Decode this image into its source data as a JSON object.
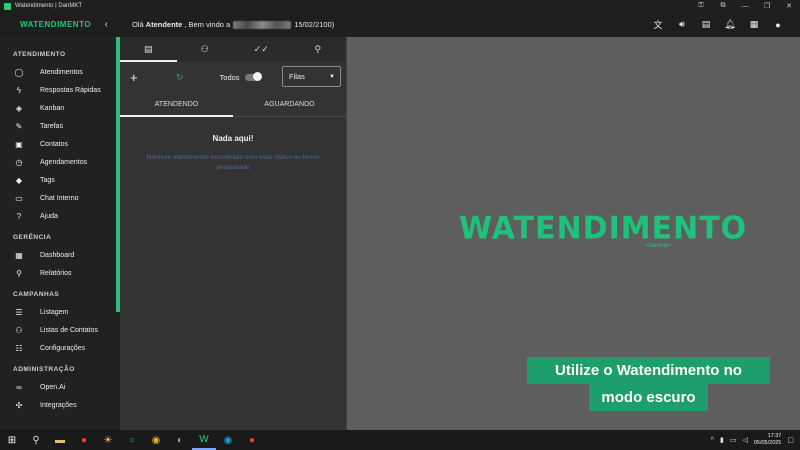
{
  "window": {
    "title": "Watendimento | DanMKT",
    "controls": [
      "key-icon",
      "puzzle-icon",
      "minimize",
      "maximize",
      "close"
    ]
  },
  "header": {
    "brand": "WATENDIMENTO",
    "greeting_prefix": "Olá",
    "user": "Atendente",
    "greeting_mid": ", Bem vindo a",
    "greeting_suffix": "15/02/2100)",
    "icons": [
      "translate-icon",
      "volume-icon",
      "chat-icon",
      "bell-icon",
      "messages-icon",
      "account-icon"
    ]
  },
  "sidebar": {
    "sections": [
      {
        "title": "ATENDIMENTO",
        "items": [
          {
            "label": "Atendimentos",
            "icon": "whatsapp-icon"
          },
          {
            "label": "Respostas Rápidas",
            "icon": "flash-icon"
          },
          {
            "label": "Kanban",
            "icon": "tags-icon"
          },
          {
            "label": "Tarefas",
            "icon": "pencil-icon"
          },
          {
            "label": "Contatos",
            "icon": "contacts-icon"
          },
          {
            "label": "Agendamentos",
            "icon": "clock-icon"
          },
          {
            "label": "Tags",
            "icon": "tag-icon"
          },
          {
            "label": "Chat Interno",
            "icon": "forum-icon"
          },
          {
            "label": "Ajuda",
            "icon": "help-icon"
          }
        ]
      },
      {
        "title": "GERÊNCIA",
        "items": [
          {
            "label": "Dashboard",
            "icon": "dashboard-icon"
          },
          {
            "label": "Relatórios",
            "icon": "search-icon"
          }
        ]
      },
      {
        "title": "CAMPANHAS",
        "items": [
          {
            "label": "Listagem",
            "icon": "list-icon"
          },
          {
            "label": "Listas de Contatos",
            "icon": "people-icon"
          },
          {
            "label": "Configurações",
            "icon": "settings-list-icon"
          }
        ]
      },
      {
        "title": "ADMINISTRAÇÃO",
        "items": [
          {
            "label": "Open.Ai",
            "icon": "infinity-icon"
          },
          {
            "label": "Integrações",
            "icon": "hub-icon"
          }
        ]
      }
    ]
  },
  "list_panel": {
    "tabs": [
      "chat-icon",
      "group-icon",
      "done-all-icon",
      "search-icon"
    ],
    "todos_label": "Todos",
    "queue_select": "Filas",
    "subtabs": [
      "ATENDENDO",
      "AGUARDANDO"
    ],
    "empty_title": "Nada aqui!",
    "empty_text": "Nenhum atendimento encontrado com esse status ou termo pesquisado"
  },
  "main": {
    "logo_text": "WATENDIMENTO",
    "logo_sub": "<danmkt>",
    "promo_line1": "Utilize o Watendimento no",
    "promo_line2": "modo escuro"
  },
  "taskbar": {
    "time": "17:37",
    "date": "05/05/2025"
  }
}
